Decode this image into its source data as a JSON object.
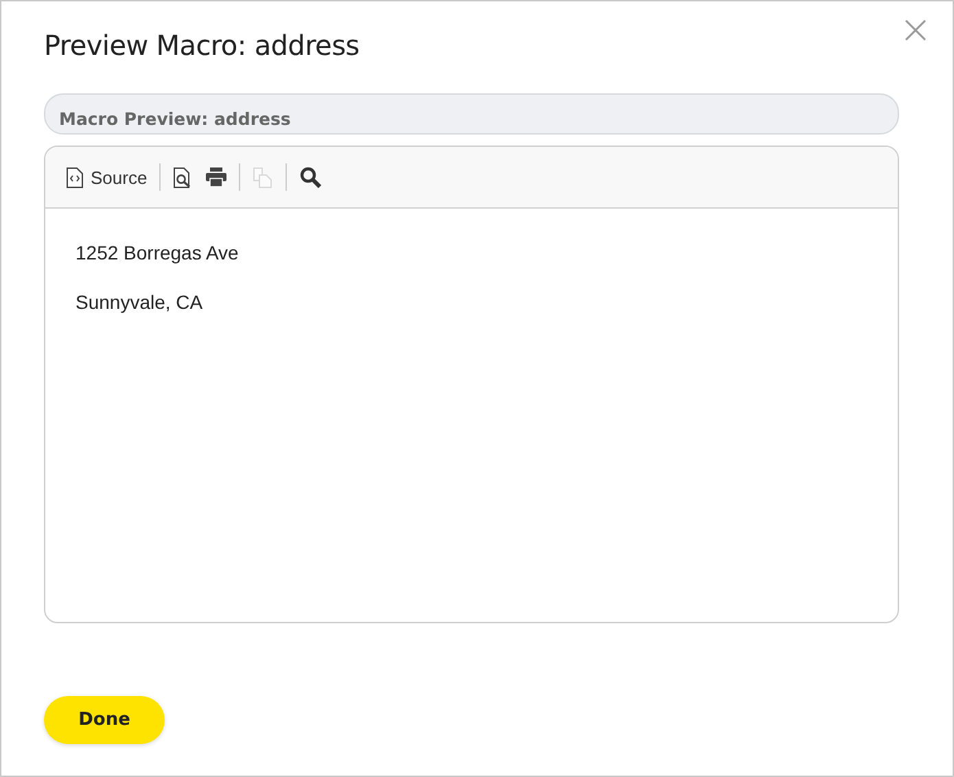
{
  "dialog": {
    "title": "Preview Macro: address"
  },
  "panel": {
    "title": "Macro Preview: address"
  },
  "toolbar": [
    {
      "kind": "source",
      "label": "Source",
      "disabled": false
    },
    {
      "kind": "separator"
    },
    {
      "kind": "preview",
      "disabled": false
    },
    {
      "kind": "print",
      "disabled": false
    },
    {
      "kind": "separator"
    },
    {
      "kind": "copy",
      "disabled": true
    },
    {
      "kind": "separator"
    },
    {
      "kind": "find",
      "disabled": false
    }
  ],
  "content": [
    "1252 Borregas Ave",
    "Sunnyvale, CA"
  ],
  "buttons": [
    {
      "label": "Done"
    }
  ]
}
